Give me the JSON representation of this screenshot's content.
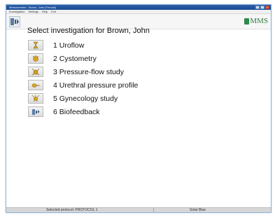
{
  "window": {
    "title": "Measurement - Brown, John [Female]"
  },
  "menu": {
    "items": [
      "Investigation",
      "Settings",
      "Help",
      "Exit"
    ]
  },
  "brand": {
    "name": "MMS",
    "color": "#2e7d44"
  },
  "main": {
    "heading": "Select investigation for Brown, John",
    "investigations": [
      {
        "label": "1 Uroflow",
        "icon": "uroflow-icon",
        "color": "#c9a227"
      },
      {
        "label": "2 Cystometry",
        "icon": "cystometry-icon",
        "color": "#d8a61a"
      },
      {
        "label": "3 Pressure-flow study",
        "icon": "pressure-flow-icon",
        "color": "#d39c18"
      },
      {
        "label": "4 Urethral pressure profile",
        "icon": "urethral-profile-icon",
        "color": "#e0a818"
      },
      {
        "label": "5 Gynecology study",
        "icon": "gynecology-icon",
        "color": "#d9a31c"
      },
      {
        "label": "6 Biofeedback",
        "icon": "biofeedback-icon",
        "color": "#5b7fa6"
      }
    ]
  },
  "status": {
    "protocol": "Selected protocol: PROTOCOL 1",
    "device": "Solar Blue"
  }
}
